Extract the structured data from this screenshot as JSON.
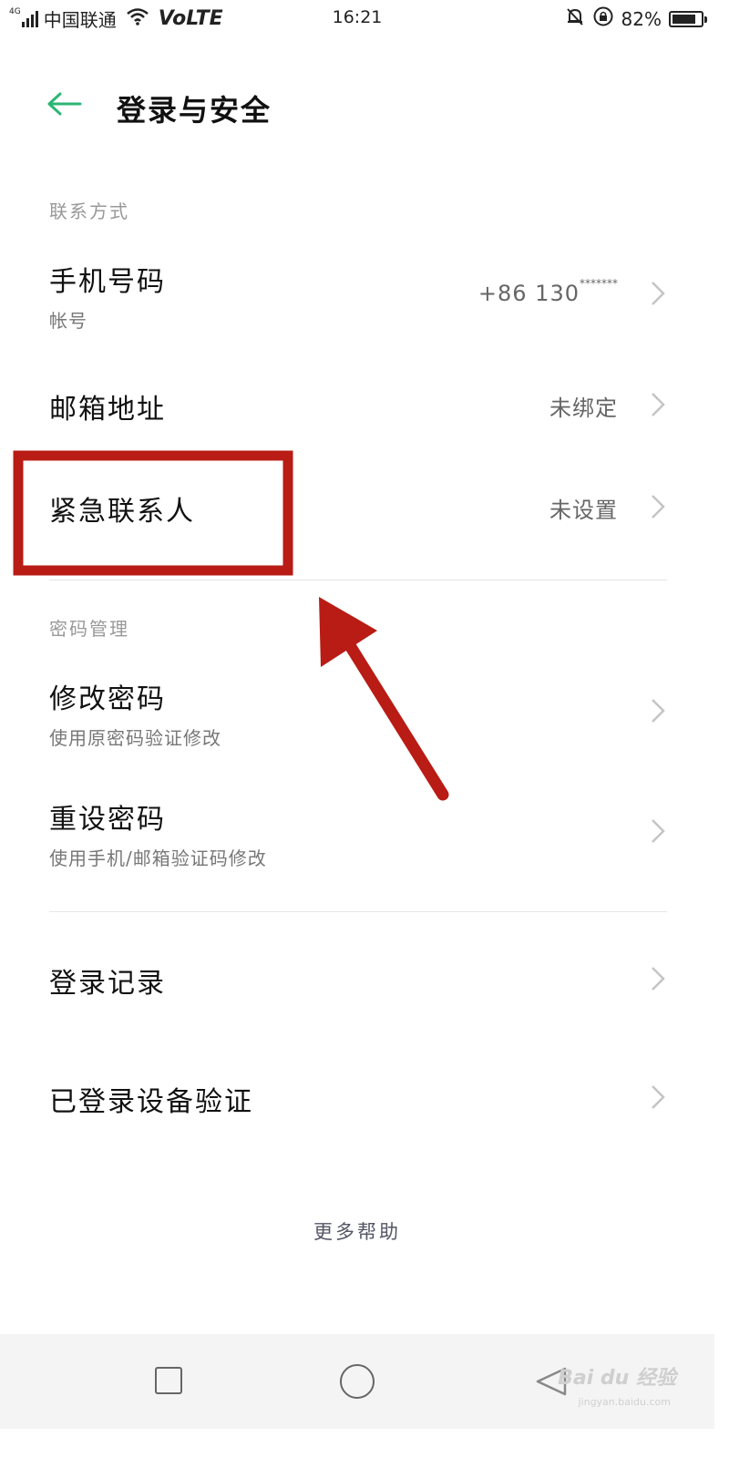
{
  "status_bar": {
    "network_type": "4G",
    "carrier": "中国联通",
    "volte": "VoLTE",
    "time": "16:21",
    "battery_percent": "82%",
    "battery_level": 0.82,
    "icons": [
      "signal-icon",
      "wifi-icon",
      "mute-icon",
      "rotation-lock-icon",
      "battery-icon"
    ]
  },
  "header": {
    "title": "登录与安全",
    "back_icon": "back-arrow-icon",
    "accent_color": "#2bb673"
  },
  "sections": {
    "contact": {
      "header": "联系方式",
      "phone": {
        "label": "手机号码",
        "sub": "帐号",
        "value_prefix": "+86 130",
        "value_masked": "*******"
      },
      "email": {
        "label": "邮箱地址",
        "value": "未绑定"
      },
      "emergency": {
        "label": "紧急联系人",
        "value": "未设置"
      }
    },
    "password": {
      "header": "密码管理",
      "change": {
        "label": "修改密码",
        "sub": "使用原密码验证修改"
      },
      "reset": {
        "label": "重设密码",
        "sub": "使用手机/邮箱验证码修改"
      }
    },
    "login": {
      "records": {
        "label": "登录记录"
      },
      "device_verify": {
        "label": "已登录设备验证"
      }
    }
  },
  "footer": {
    "more_help": "更多帮助"
  },
  "nav_bar": {
    "icons": [
      "recent-apps-icon",
      "home-icon",
      "back-icon"
    ],
    "watermark": "Bai du 经验",
    "watermark_url": "jingyan.baidu.com"
  },
  "annotation": {
    "color": "#b81c15"
  }
}
